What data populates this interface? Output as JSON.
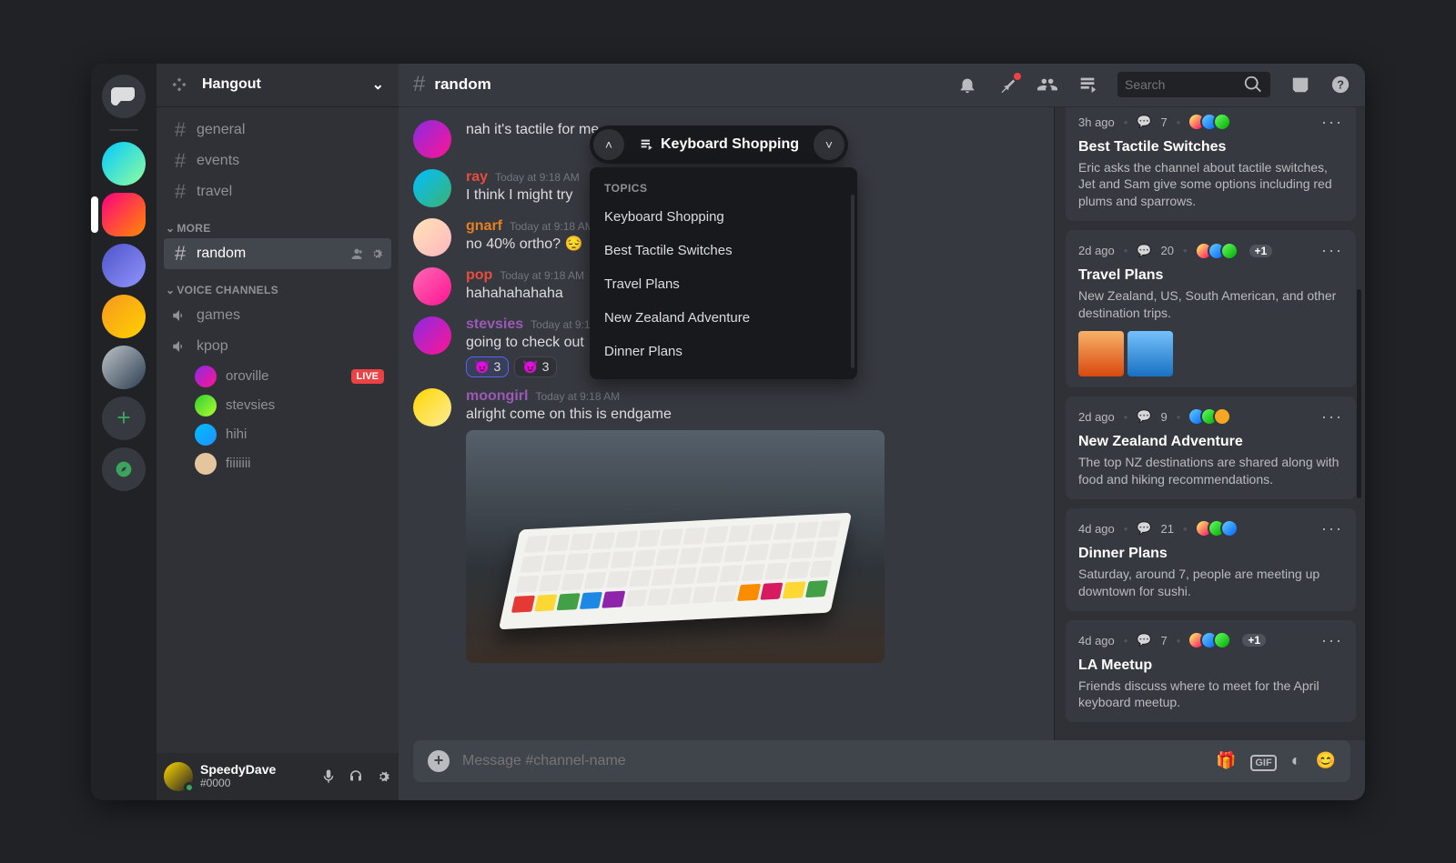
{
  "server": {
    "name": "Hangout"
  },
  "channel": {
    "name": "random"
  },
  "search": {
    "placeholder": "Search"
  },
  "categories": {
    "more": "MORE",
    "voice": "VOICE CHANNELS"
  },
  "channels": {
    "general": "general",
    "events": "events",
    "travel": "travel",
    "random": "random",
    "games": "games",
    "kpop": "kpop"
  },
  "voice_users": {
    "u1": "oroville",
    "u2": "stevsies",
    "u3": "hihi",
    "u4": "fiiiiiii",
    "live": "LIVE"
  },
  "self": {
    "name": "SpeedyDave",
    "tag": "#0000"
  },
  "composer": {
    "placeholder": "Message #channel-name"
  },
  "messages": {
    "m1": {
      "text": "nah it's tactile for me"
    },
    "m2": {
      "author": "ray",
      "ts": "Today at 9:18 AM",
      "text": "I think I might try"
    },
    "m3": {
      "author": "gnarf",
      "ts": "Today at 9:18 AM",
      "text": "no 40% ortho? 😔"
    },
    "m4": {
      "author": "pop",
      "ts": "Today at 9:18 AM",
      "text": "hahahahahaha"
    },
    "m5": {
      "author": "stevsies",
      "ts": "Today at 9:18 AM",
      "text": "going to check out",
      "r1": "3",
      "r2": "3"
    },
    "m6": {
      "author": "moongirl",
      "ts": "Today at 9:18 AM",
      "text": "alright come on this is endgame"
    }
  },
  "topic_pill": {
    "label": "Keyboard Shopping"
  },
  "topic_menu": {
    "header": "TOPICS",
    "t1": "Keyboard Shopping",
    "t2": "Best Tactile Switches",
    "t3": "Travel Plans",
    "t4": "New Zealand Adventure",
    "t5": "Dinner Plans"
  },
  "threads": {
    "c1": {
      "age": "3h ago",
      "count": "7",
      "title": "Best Tactile Switches",
      "desc": "Eric asks the channel about tactile switches, Jet and Sam give some options including red plums and sparrows."
    },
    "c2": {
      "age": "2d ago",
      "count": "20",
      "plus": "+1",
      "title": "Travel Plans",
      "desc": "New Zealand, US,  South American, and other destination trips."
    },
    "c3": {
      "age": "2d ago",
      "count": "9",
      "title": "New Zealand Adventure",
      "desc": "The top NZ destinations are shared along with food and hiking recommendations."
    },
    "c4": {
      "age": "4d ago",
      "count": "21",
      "title": "Dinner Plans",
      "desc": "Saturday, around 7, people are meeting up downtown for sushi."
    },
    "c5": {
      "age": "4d ago",
      "count": "7",
      "plus": "+1",
      "title": "LA Meetup",
      "desc": "Friends discuss where to meet for the April keyboard meetup."
    }
  }
}
